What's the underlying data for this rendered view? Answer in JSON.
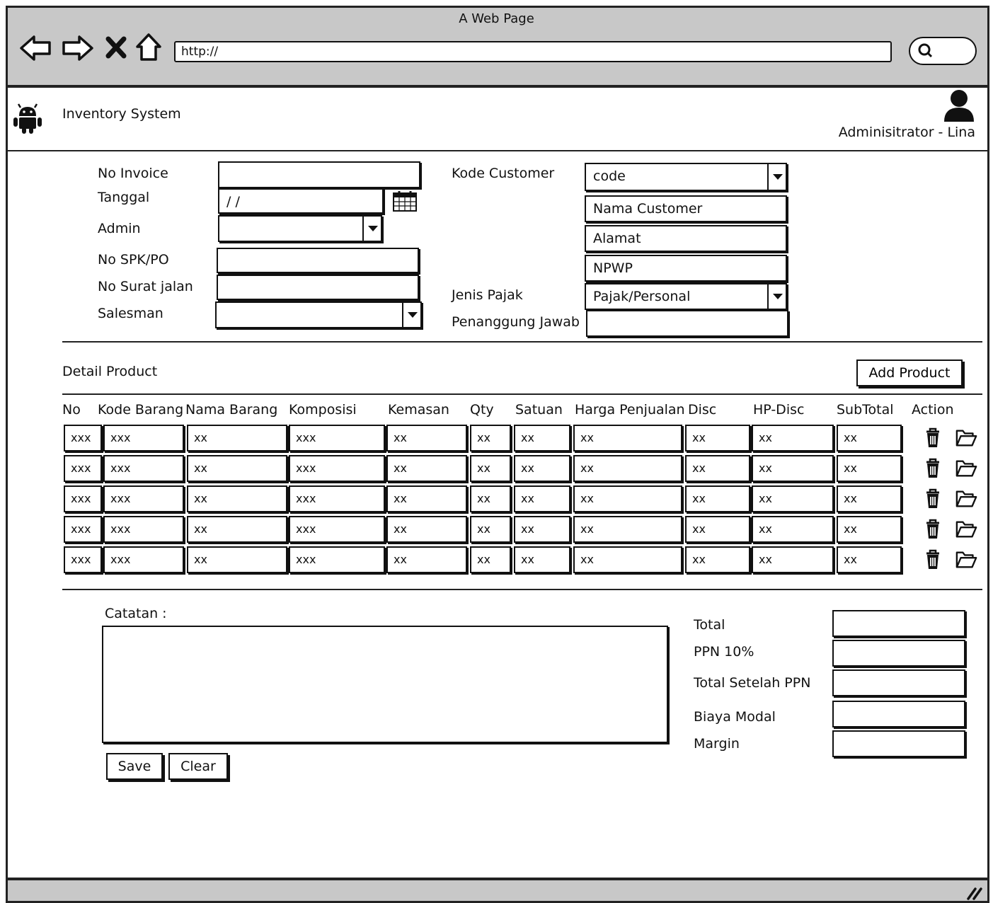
{
  "browser": {
    "window_title": "A Web Page",
    "url": "http://"
  },
  "header": {
    "app_title": "Inventory System",
    "user": "Adminisitrator - Lina"
  },
  "form": {
    "no_invoice_label": "No Invoice",
    "tanggal_label": "Tanggal",
    "tanggal_value": "/ /",
    "admin_label": "Admin",
    "no_spk_label": "No SPK/PO",
    "no_surat_label": "No Surat jalan",
    "salesman_label": "Salesman",
    "kode_customer_label": "Kode Customer",
    "kode_customer_value": "code",
    "nama_customer_placeholder": "Nama Customer",
    "alamat_placeholder": "Alamat",
    "npwp_placeholder": "NPWP",
    "jenis_pajak_label": "Jenis Pajak",
    "jenis_pajak_value": "Pajak/Personal",
    "penanggung_label": "Penanggung Jawab"
  },
  "detail": {
    "title": "Detail Product",
    "add_button": "Add Product",
    "columns": [
      "No",
      "Kode Barang",
      "Nama Barang",
      "Komposisi",
      "Kemasan",
      "Qty",
      "Satuan",
      "Harga Penjualan",
      "Disc",
      "HP-Disc",
      "SubTotal",
      "Action"
    ],
    "rows": [
      [
        "xxx",
        "xxx",
        "xx",
        "xxx",
        "xx",
        "xx",
        "xx",
        "xx",
        "xx",
        "xx",
        "xx"
      ],
      [
        "xxx",
        "xxx",
        "xx",
        "xxx",
        "xx",
        "xx",
        "xx",
        "xx",
        "xx",
        "xx",
        "xx"
      ],
      [
        "xxx",
        "xxx",
        "xx",
        "xxx",
        "xx",
        "xx",
        "xx",
        "xx",
        "xx",
        "xx",
        "xx"
      ],
      [
        "xxx",
        "xxx",
        "xx",
        "xxx",
        "xx",
        "xx",
        "xx",
        "xx",
        "xx",
        "xx",
        "xx"
      ],
      [
        "xxx",
        "xxx",
        "xx",
        "xxx",
        "xx",
        "xx",
        "xx",
        "xx",
        "xx",
        "xx",
        "xx"
      ]
    ],
    "action_icons": [
      "trash-icon",
      "folder-open-icon"
    ]
  },
  "footer_form": {
    "notes_label": "Catatan :",
    "save_button": "Save",
    "clear_button": "Clear",
    "total_label": "Total",
    "ppn_label": "PPN 10%",
    "total_ppn_label": "Total Setelah PPN",
    "biaya_modal_label": "Biaya Modal",
    "margin_label": "Margin"
  },
  "colors": {
    "chrome_gray": "#c8c8c8",
    "ink": "#111111"
  }
}
